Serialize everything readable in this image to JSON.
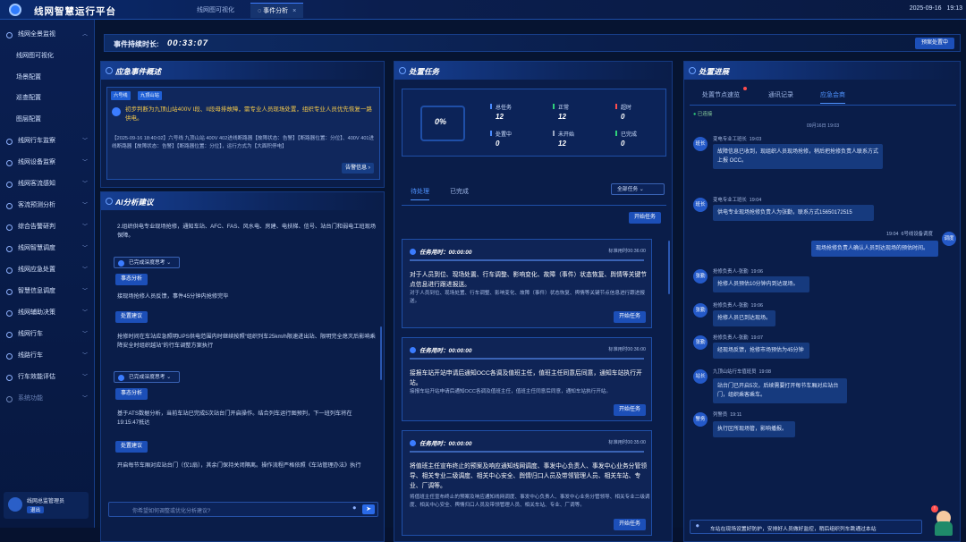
{
  "app": {
    "title": "线网智慧运行平台"
  },
  "tabs": [
    {
      "label": "线网图可视化"
    },
    {
      "label": "事件分析",
      "close": "×"
    }
  ],
  "datetime": {
    "date": "2025-09-16",
    "time": "19:13"
  },
  "sidebar": {
    "items": [
      {
        "label": "线网全景监视",
        "arrow": "︿"
      },
      {
        "label": "线网图可视化",
        "sub": true
      },
      {
        "label": "场景配置",
        "sub": true
      },
      {
        "label": "巡查配置",
        "sub": true
      },
      {
        "label": "图层配置",
        "sub": true
      },
      {
        "label": "线网行车监察",
        "arrow": "﹀"
      },
      {
        "label": "线网设备监察",
        "arrow": "﹀"
      },
      {
        "label": "线网客流感知",
        "arrow": "﹀"
      },
      {
        "label": "客流预测分析",
        "arrow": "﹀"
      },
      {
        "label": "综合告警研判",
        "arrow": "﹀"
      },
      {
        "label": "线网智慧调度",
        "arrow": "﹀"
      },
      {
        "label": "线网应急处置",
        "arrow": "﹀"
      },
      {
        "label": "智慧信息调度",
        "arrow": "﹀"
      },
      {
        "label": "线网辅助决策",
        "arrow": "﹀"
      },
      {
        "label": "线网行车",
        "arrow": "﹀"
      },
      {
        "label": "线路行车",
        "arrow": "﹀"
      },
      {
        "label": "行车效能评估",
        "arrow": "﹀"
      },
      {
        "label": "系统功能",
        "arrow": "﹀",
        "disabled": true
      }
    ],
    "user": {
      "name": "线网总监管理员",
      "logout": "退出"
    }
  },
  "duration": {
    "label": "事件持续时长:",
    "value": "00:33:07",
    "button": "预案处置中"
  },
  "overview": {
    "title": "应急事件概述",
    "tags": [
      "六号线",
      "九顶山站"
    ],
    "headline": "初步判断为九顶山站400V I段、II段母排故障，需专业人员现场处置，组织专业人员优先恢复一路供电。",
    "detail": "【2025-09-16 18:40:02】六号线 九顶山站 400V 402进线断路器【故障状态：告警】【断路器位置：分位】、400V 401进线断路器【故障状态：告警】【断路器位置：分位】，运行方式为【大面积停电】",
    "alarm_button": "告警信息"
  },
  "ai": {
    "title": "AI分析建议",
    "text1": "2.组织供电专业现场抢修，通知车站、AFC、FAS、风水电、房建、电扶梯、信号、站台门和弱电工班现场保障。",
    "dd1": "已完成深度思考",
    "btn1": "事态分析",
    "text2": "接现场抢修人员反馈，事件45分钟内抢修完毕",
    "btn2": "处置建议",
    "text3": "抢修时间在车站应急照明UPS供电范围内时继续按照“组织列车25km/h限速进出站、限明完全熄灭后影响乘降安全时组织越站”的行车调整方案执行",
    "dd2": "已完成深度思考",
    "btn3": "事态分析",
    "text4": "基于ATS数据分析，当前车站已完成5次站台门开启操作。结合列车运行图预判，下一班列车将在19:15:47抵达",
    "btn4": "处置建议",
    "text5": "开启每节车厢对应站台门（仅1扇），其余门保持关闭隔离。操作流程严格依照《车站管理办法》执行",
    "input_placeholder": "你希望如何调整或优化分析建议?"
  },
  "tasks": {
    "title": "处置任务",
    "percent": "0%",
    "stats": [
      {
        "label": "总任务",
        "value": "12",
        "color": "#4a8bff"
      },
      {
        "label": "正常",
        "value": "12",
        "color": "#2fd17a"
      },
      {
        "label": "超时",
        "value": "0",
        "color": "#ff4d4d"
      },
      {
        "label": "处置中",
        "value": "0",
        "color": "#4a8bff"
      },
      {
        "label": "未开始",
        "value": "12",
        "color": "#9aa7c2"
      },
      {
        "label": "已完成",
        "value": "0",
        "color": "#2fd17a"
      }
    ],
    "subtabs": [
      "待处理",
      "已完成"
    ],
    "filter": "全部任务",
    "start_label": "开始任务",
    "list": [
      {
        "head": "任务用时：00:00:00",
        "limit": "标准用时00:36:00",
        "main": "对于人员到位、现场处置、行车调整、影响变化、故障（事件）状态恢复、舆情等关键节点信息进行跟进报送。",
        "sub": "对于人员到位、现场处置、行车调整、影响变化、故障（事件）状态恢复、舆情等关键节点信息进行跟进报送。"
      },
      {
        "head": "任务用时：00:00:00",
        "limit": "标准用时00:36:00",
        "main": "接报车站开站申请后通知OCC各调及值班主任，值班主任同意后同意，通知车站执行开站。",
        "sub": "接报车站开站申请后通知OCC各调及值班主任，值班主任同意后同意，通知车站执行开站。"
      },
      {
        "head": "任务用时：00:00:00",
        "limit": "标准用时00:35:00",
        "main": "将值班主任宣布终止的预案及响应通知线网调度、事发中心负责人、事发中心业务分管领导、相关专业二级调度、相关中心安全、舆情归口人员及带领管理人员、相关车站、专业、厂调等。",
        "sub": "将值班主任宣布终止的预案及响应通知线网调度、事发中心负责人、事发中心业务分管领导、相关专业二级调度、相关中心安全、舆情归口人员及带领管理人员、相关车站、专业、厂调等。"
      }
    ]
  },
  "progress": {
    "title": "处置进展",
    "subtabs": [
      "处置节点速览",
      "通讯记录",
      "应急会商"
    ],
    "connected": "已连接",
    "divider": "09月16日 19:03",
    "messages": [
      {
        "avatar": "班长",
        "name": "变电专业工班长",
        "time": "19:03",
        "text": "故障信息已收到，现组织人员现场抢修，稍后把抢修负责人联系方式上报 OCC。",
        "side": "left"
      },
      {
        "avatar": "班长",
        "name": "变电专业工班长",
        "time": "19:04",
        "text": "供电专业现场抢修负责人为张勤，联系方式15650172515",
        "side": "left"
      },
      {
        "avatar": "调度",
        "name": "6号线设备调度",
        "time": "19:04",
        "text": "现场抢修负责人确认人员到达现场的预估时间。",
        "side": "right"
      },
      {
        "avatar": "张勤",
        "name": "抢修负责人-张勤",
        "time": "19:06",
        "text": "抢修人员预估10分钟内到达现场。",
        "side": "left"
      },
      {
        "avatar": "张勤",
        "name": "抢修负责人-张勤",
        "time": "19:06",
        "text": "抢修人员已到达现场。",
        "side": "left"
      },
      {
        "avatar": "张勤",
        "name": "抢修负责人-张勤",
        "time": "19:07",
        "text": "经现场反馈，抢修市场预估为45分钟",
        "side": "left"
      },
      {
        "avatar": "站长",
        "name": "九顶山站行车值班员",
        "time": "19:08",
        "text": "站台门已开启5次，后续需要打开每节车厢对应站台门，组织乘客乘车。",
        "side": "left"
      },
      {
        "avatar": "警务",
        "name": "列警员",
        "time": "19:11",
        "text": "执行区所现场管，影响播报。",
        "side": "left"
      }
    ],
    "input_text": "车站在现场设置好防护，安排好人员做好监控，稍后组织列车跳通过本站"
  }
}
